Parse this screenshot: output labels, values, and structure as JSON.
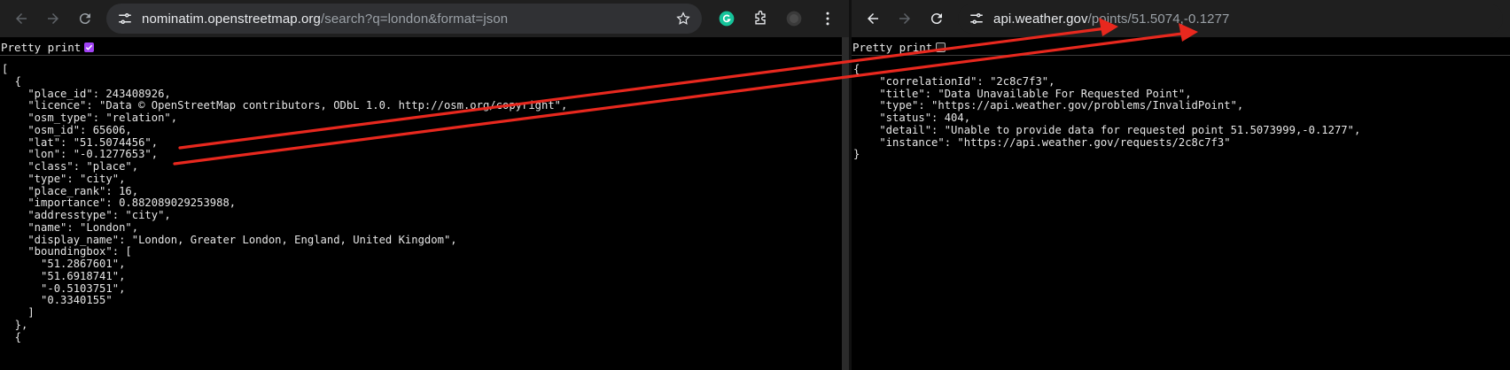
{
  "left": {
    "url_host": "nominatim.openstreetmap.org",
    "url_path": "/search?q=london&format=json",
    "pretty_print_label": "Pretty print",
    "pretty_print_checked": true,
    "lines": [
      "[",
      "  {",
      "    \"place_id\": 243408926,",
      "    \"licence\": \"Data © OpenStreetMap contributors, ODbL 1.0. http://osm.org/copyright\",",
      "    \"osm_type\": \"relation\",",
      "    \"osm_id\": 65606,",
      "    \"lat\": \"51.5074456\",",
      "    \"lon\": \"-0.1277653\",",
      "    \"class\": \"place\",",
      "    \"type\": \"city\",",
      "    \"place_rank\": 16,",
      "    \"importance\": 0.882089029253988,",
      "    \"addresstype\": \"city\",",
      "    \"name\": \"London\",",
      "    \"display_name\": \"London, Greater London, England, United Kingdom\",",
      "    \"boundingbox\": [",
      "      \"51.2867601\",",
      "      \"51.6918741\",",
      "      \"-0.5103751\",",
      "      \"0.3340155\"",
      "    ]",
      "  },",
      "  {"
    ]
  },
  "right": {
    "url_host": "api.weather.gov",
    "url_path": "/points/51.5074,-0.1277",
    "pretty_print_label": "Pretty print",
    "pretty_print_checked": false,
    "lines": [
      "{",
      "    \"correlationId\": \"2c8c7f3\",",
      "    \"title\": \"Data Unavailable For Requested Point\",",
      "    \"type\": \"https://api.weather.gov/problems/InvalidPoint\",",
      "    \"status\": 404,",
      "    \"detail\": \"Unable to provide data for requested point 51.5073999,-0.1277\",",
      "    \"instance\": \"https://api.weather.gov/requests/2c8c7f3\"",
      "}"
    ]
  },
  "icons": {
    "back": "arrow-back-icon",
    "forward": "arrow-forward-icon",
    "reload": "reload-icon",
    "site_info": "tune-icon",
    "bookmark": "star-icon",
    "grammarly": "grammarly-icon",
    "extensions": "puzzle-icon",
    "profile": "profile-icon",
    "menu": "kebab-menu-icon"
  },
  "colors": {
    "arrow": "#e8281e",
    "checkbox_checked": "#a142f4",
    "grammarly": "#15c39a"
  }
}
